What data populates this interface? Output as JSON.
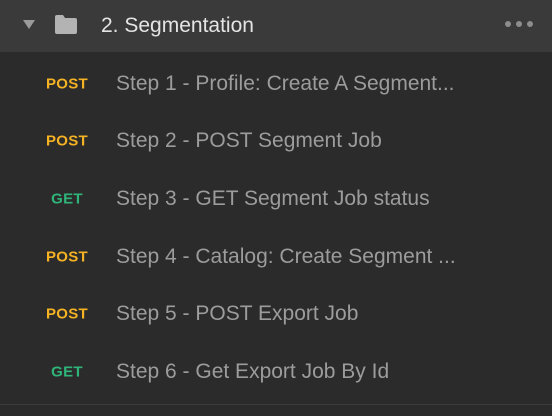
{
  "folder": {
    "title": "2. Segmentation",
    "expanded": true,
    "icon": "folder-icon",
    "header_bg": "#3a3a3a"
  },
  "colors": {
    "POST": "#f5b324",
    "GET": "#2fb479",
    "text": "#9c9c9c"
  },
  "requests": [
    {
      "method": "POST",
      "name": "Step 1 - Profile: Create A Segment..."
    },
    {
      "method": "POST",
      "name": "Step 2 - POST Segment Job"
    },
    {
      "method": "GET",
      "name": "Step 3 - GET Segment Job status"
    },
    {
      "method": "POST",
      "name": "Step 4 - Catalog: Create Segment ..."
    },
    {
      "method": "POST",
      "name": "Step 5 - POST Export Job"
    },
    {
      "method": "GET",
      "name": "Step 6 - Get Export Job By Id"
    }
  ]
}
